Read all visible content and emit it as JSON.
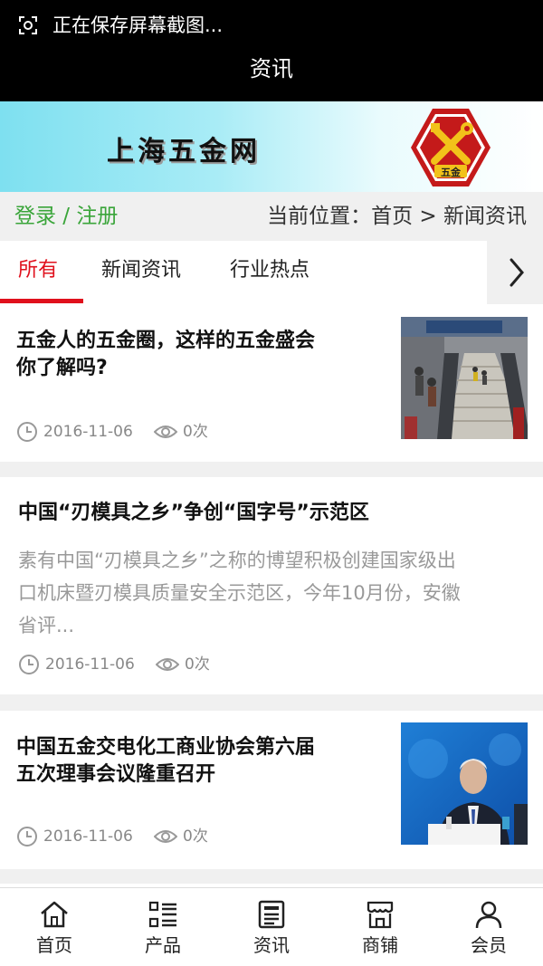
{
  "status_bar": {
    "text": "正在保存屏幕截图..."
  },
  "header": {
    "title": "资讯"
  },
  "banner": {
    "site_name": "上海五金网",
    "logo_text": "五金"
  },
  "location_bar": {
    "login_label": "登录 / 注册",
    "breadcrumb": "当前位置：首页 > 新闻资讯"
  },
  "tabs": [
    {
      "label": "所有",
      "active": true
    },
    {
      "label": "新闻资讯",
      "active": false
    },
    {
      "label": "行业热点",
      "active": false
    }
  ],
  "articles": [
    {
      "title_line1": "五金人的五金圈，这样的五金盛会",
      "title_line2": "你了解吗?",
      "date": "2016-11-06",
      "views": "0次",
      "has_image": true,
      "image_desc": "展会楼梯扶梯人群"
    },
    {
      "title": "中国“刃模具之乡”争创“国字号”示范区",
      "summary_line1": "素有中国“刃模具之乡”之称的博望积极创建国家级出",
      "summary_line2": "口机床暨刃模具质量安全示范区，今年10月份，安徽",
      "summary_line3": "省评...",
      "date": "2016-11-06",
      "views": "0次",
      "has_image": false
    },
    {
      "title_line1": "中国五金交电化工商业协会第六届",
      "title_line2": "五次理事会议隆重召开",
      "date": "2016-11-06",
      "views": "0次",
      "has_image": true,
      "image_desc": "会议发言人"
    }
  ],
  "bottom_nav": [
    {
      "label": "首页",
      "icon": "home-icon"
    },
    {
      "label": "产品",
      "icon": "grid-list-icon"
    },
    {
      "label": "资讯",
      "icon": "news-icon"
    },
    {
      "label": "商铺",
      "icon": "shop-icon"
    },
    {
      "label": "会员",
      "icon": "user-icon"
    }
  ],
  "colors": {
    "accent": "#e0101c",
    "login_green": "#3aa53a",
    "meta_gray": "#888888"
  }
}
